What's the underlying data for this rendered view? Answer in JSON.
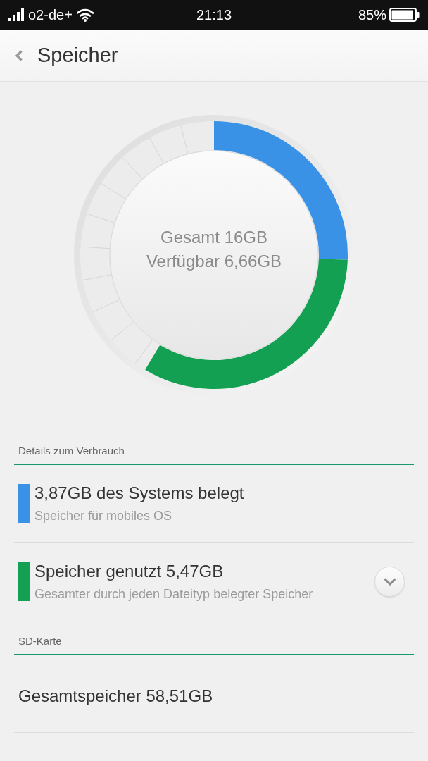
{
  "status_bar": {
    "carrier": "o2-de+",
    "time": "21:13",
    "battery": "85%"
  },
  "header": {
    "title": "Speicher"
  },
  "storage_ring": {
    "total": "Gesamt 16GB",
    "available": "Verfügbar 6,66GB"
  },
  "sections": [
    {
      "heading": "Details zum Verbrauch",
      "items": [
        {
          "kind": "usage",
          "title": "3,87GB des Systems belegt",
          "subtitle": "Speicher für mobiles OS",
          "color": "#3a92e6"
        },
        {
          "kind": "expandable",
          "title": "Speicher genutzt 5,47GB",
          "subtitle": "Gesamter durch jeden Dateityp belegter Speicher",
          "color": "#13a052",
          "expanded": false
        }
      ]
    },
    {
      "heading": "SD-Karte",
      "items": [
        {
          "kind": "plain",
          "title": "Gesamtspeicher 58,51GB"
        }
      ]
    }
  ]
}
